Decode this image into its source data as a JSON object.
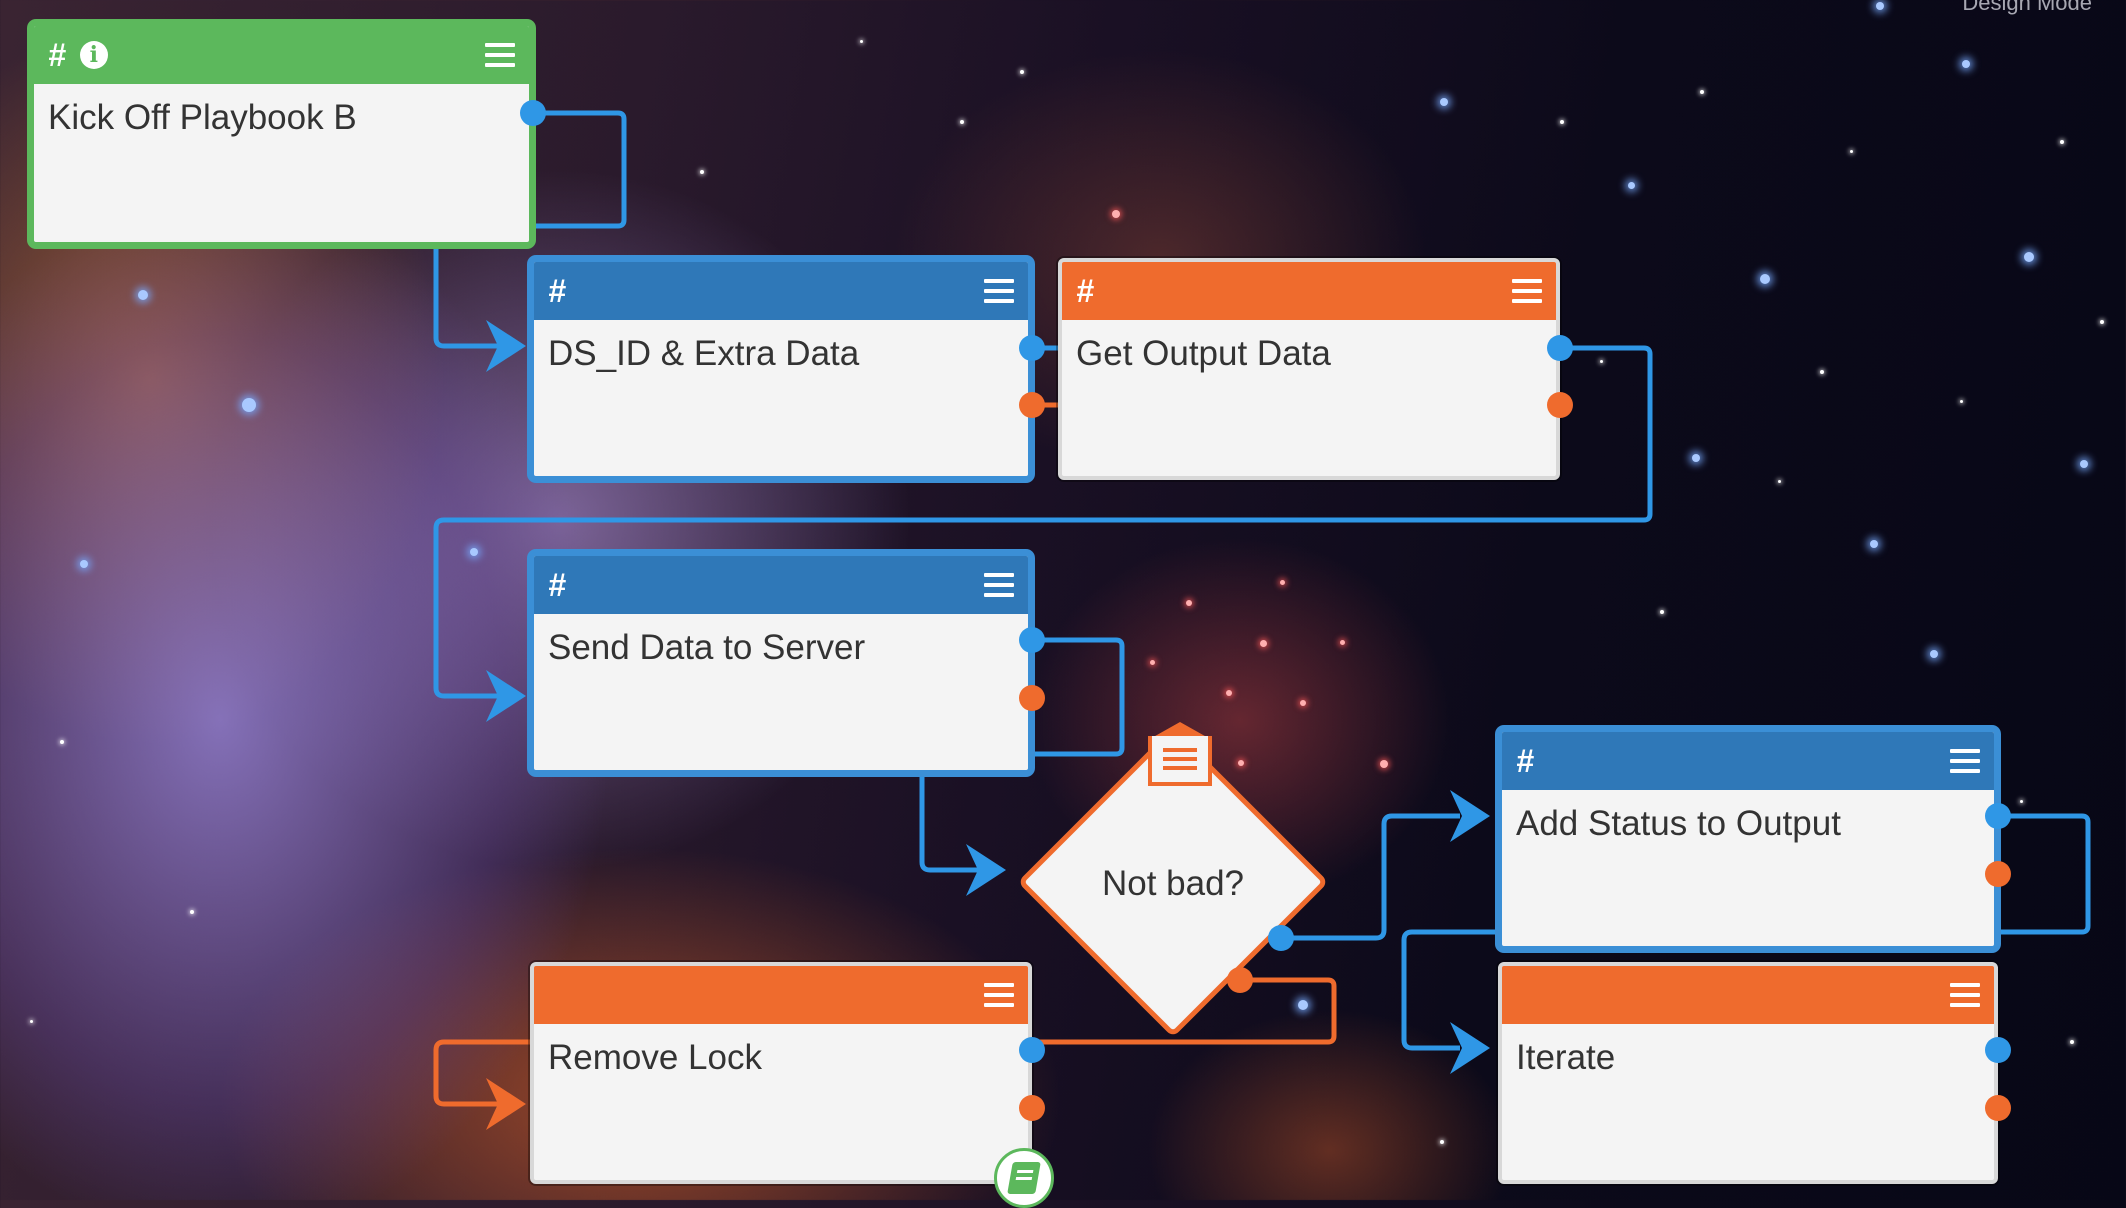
{
  "canvas": {
    "mode_label": "Design Mode"
  },
  "blocks": {
    "kickoff": {
      "title": "Kick Off Playbook B",
      "type": "start",
      "color": "#5cb85c",
      "icon": "info-icon"
    },
    "ds_id": {
      "title": "DS_ID & Extra Data",
      "type": "code",
      "color": "#2f78b8"
    },
    "get_output": {
      "title": "Get Output Data",
      "type": "action",
      "color": "#ef6b2d"
    },
    "send_data": {
      "title": "Send Data to Server",
      "type": "code",
      "color": "#2f78b8"
    },
    "remove_lock": {
      "title": "Remove Lock",
      "type": "action",
      "color": "#ef6b2d"
    },
    "add_status": {
      "title": "Add Status to Output",
      "type": "code",
      "color": "#2f78b8"
    },
    "iterate": {
      "title": "Iterate",
      "type": "action",
      "color": "#ef6b2d"
    }
  },
  "decision": {
    "label": "Not bad?",
    "color": "#ef6b2d"
  },
  "header_symbol": "#",
  "link_colors": {
    "success": "#2f97e6",
    "failure": "#ef6b2d"
  }
}
